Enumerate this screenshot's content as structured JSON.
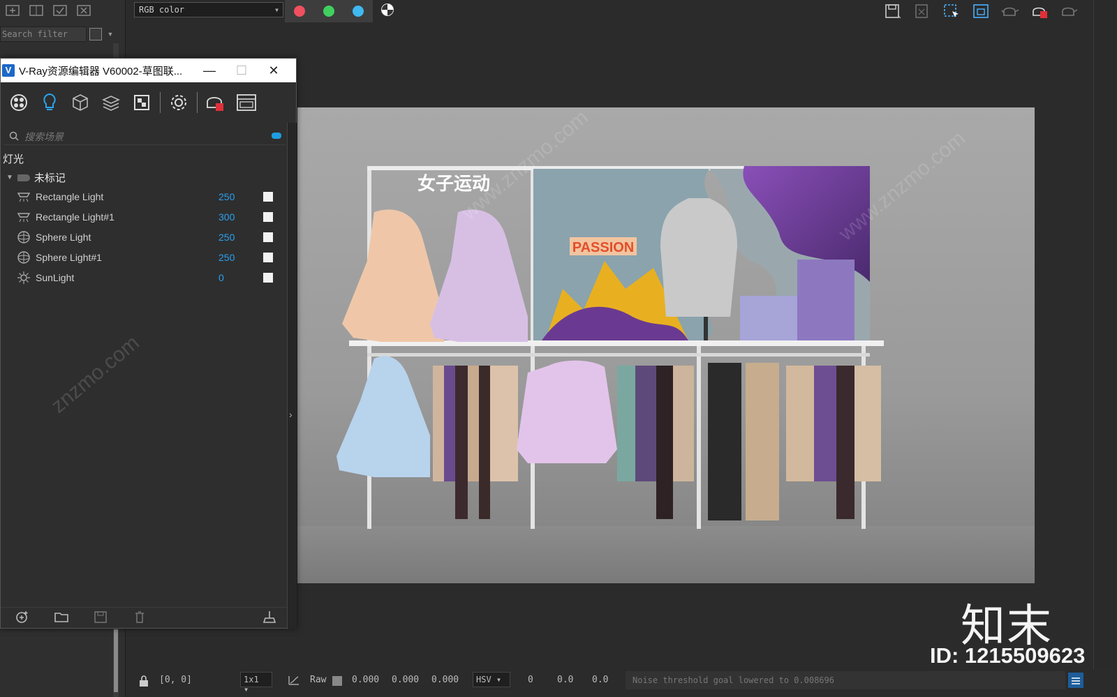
{
  "framebuffer": {
    "channel_select": "RGB color",
    "channel_colors": [
      "#f05060",
      "#40d060",
      "#40b8f0"
    ],
    "search_filter_placeholder": "Search filter"
  },
  "vray_editor": {
    "title": "V-Ray资源编辑器 V60002-草图联...",
    "window_controls": [
      "—",
      "☐",
      "✕"
    ],
    "search_placeholder": "搜索场景",
    "category": "灯光",
    "group": "未标记",
    "lights": [
      {
        "name": "Rectangle Light",
        "value": "250",
        "icon": "rectangle-light-icon"
      },
      {
        "name": "Rectangle Light#1",
        "value": "300",
        "icon": "rectangle-light-icon"
      },
      {
        "name": "Sphere Light",
        "value": "250",
        "icon": "sphere-light-icon"
      },
      {
        "name": "Sphere Light#1",
        "value": "250",
        "icon": "sphere-light-icon"
      },
      {
        "name": "SunLight",
        "value": "0",
        "icon": "sun-light-icon"
      }
    ]
  },
  "render": {
    "banner_text": "女子运动",
    "sign_text": "PASSION"
  },
  "status_bar": {
    "coords": "[0, 0]",
    "zoom": "1x1",
    "mode": "Raw",
    "values": [
      "0.000",
      "0.000",
      "0.000"
    ],
    "color_space": "HSV",
    "hsv_values": [
      "0",
      "0.0",
      "0.0"
    ],
    "message": "Noise threshold goal lowered to 0.008696"
  },
  "watermark": {
    "brand": "知末",
    "id": "ID: 1215509623"
  }
}
